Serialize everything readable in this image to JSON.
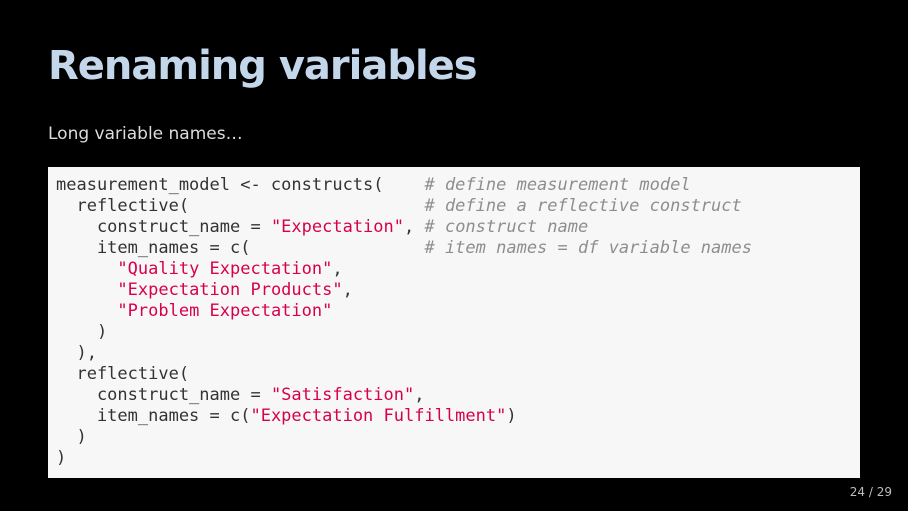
{
  "slide": {
    "title": "Renaming variables",
    "subtitle": "Long variable names…",
    "page_current": "24",
    "page_separator": " / ",
    "page_total": "29"
  },
  "code": {
    "lines": [
      [
        {
          "t": "plain",
          "s": "measurement_model <- constructs(    "
        },
        {
          "t": "comment",
          "s": "# define measurement model"
        }
      ],
      [
        {
          "t": "plain",
          "s": "  reflective(                       "
        },
        {
          "t": "comment",
          "s": "# define a reflective construct"
        }
      ],
      [
        {
          "t": "plain",
          "s": "    construct_name = "
        },
        {
          "t": "str",
          "s": "\"Expectation\""
        },
        {
          "t": "plain",
          "s": ", "
        },
        {
          "t": "comment",
          "s": "# construct name"
        }
      ],
      [
        {
          "t": "plain",
          "s": "    item_names = c(                 "
        },
        {
          "t": "comment",
          "s": "# item names = df variable names"
        }
      ],
      [
        {
          "t": "plain",
          "s": "      "
        },
        {
          "t": "str",
          "s": "\"Quality Expectation\""
        },
        {
          "t": "plain",
          "s": ","
        }
      ],
      [
        {
          "t": "plain",
          "s": "      "
        },
        {
          "t": "str",
          "s": "\"Expectation Products\""
        },
        {
          "t": "plain",
          "s": ","
        }
      ],
      [
        {
          "t": "plain",
          "s": "      "
        },
        {
          "t": "str",
          "s": "\"Problem Expectation\""
        }
      ],
      [
        {
          "t": "plain",
          "s": "    )"
        }
      ],
      [
        {
          "t": "plain",
          "s": "  ),"
        }
      ],
      [
        {
          "t": "plain",
          "s": "  reflective("
        }
      ],
      [
        {
          "t": "plain",
          "s": "    construct_name = "
        },
        {
          "t": "str",
          "s": "\"Satisfaction\""
        },
        {
          "t": "plain",
          "s": ","
        }
      ],
      [
        {
          "t": "plain",
          "s": "    item_names = c("
        },
        {
          "t": "str",
          "s": "\"Expectation Fulfillment\""
        },
        {
          "t": "plain",
          "s": ")"
        }
      ],
      [
        {
          "t": "plain",
          "s": "  )"
        }
      ],
      [
        {
          "t": "plain",
          "s": ")"
        }
      ]
    ]
  },
  "colors": {
    "background": "#000000",
    "title": "#c4d6ea",
    "code_background": "#f7f7f7",
    "code_string": "#d7004d",
    "code_comment": "#8e8e8e"
  }
}
